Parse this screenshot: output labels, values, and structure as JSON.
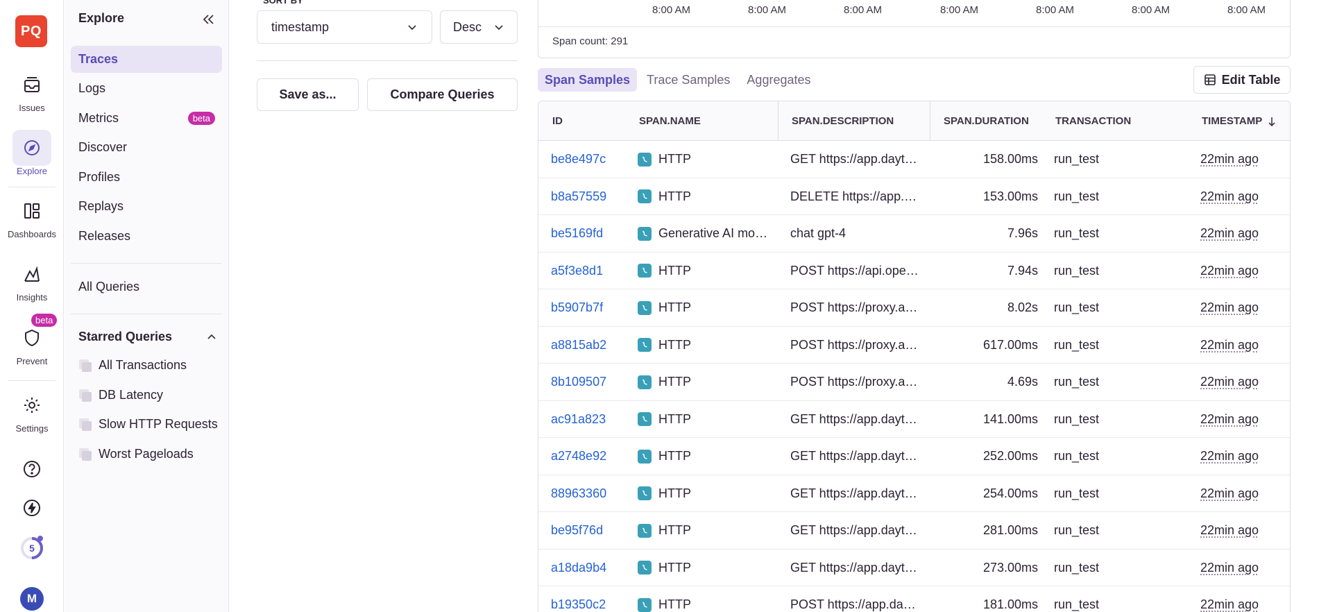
{
  "rail": {
    "logo": "PQ",
    "items": [
      {
        "label": "Issues",
        "icon": "inbox-icon"
      },
      {
        "label": "Explore",
        "icon": "compass-icon"
      },
      {
        "label": "Dashboards",
        "icon": "dashboard-icon"
      },
      {
        "label": "Insights",
        "icon": "insights-icon"
      },
      {
        "label": "Prevent",
        "icon": "shield-icon"
      },
      {
        "label": "Settings",
        "icon": "gear-icon"
      }
    ],
    "prevent_badge": "beta",
    "progress_count": "5",
    "avatar": "M"
  },
  "subnav": {
    "title": "Explore",
    "items": [
      {
        "label": "Traces"
      },
      {
        "label": "Logs"
      },
      {
        "label": "Metrics",
        "badge": "beta"
      },
      {
        "label": "Discover"
      },
      {
        "label": "Profiles"
      },
      {
        "label": "Replays"
      },
      {
        "label": "Releases"
      }
    ],
    "all_queries": "All Queries",
    "starred_title": "Starred Queries",
    "starred": [
      "All Transactions",
      "DB Latency",
      "Slow HTTP Requests",
      "Worst Pageloads"
    ]
  },
  "query": {
    "cut_label": "SORT BY",
    "sort_field": "timestamp",
    "sort_order": "Desc",
    "save_label": "Save as...",
    "compare_label": "Compare Queries"
  },
  "chart": {
    "ticks": [
      "8:00 AM",
      "8:00 AM",
      "8:00 AM",
      "8:00 AM",
      "8:00 AM",
      "8:00 AM",
      "8:00 AM"
    ],
    "span_count": "Span count: 291"
  },
  "tabs": [
    "Span Samples",
    "Trace Samples",
    "Aggregates"
  ],
  "edit_table": "Edit Table",
  "table": {
    "columns": [
      "ID",
      "SPAN.NAME",
      "SPAN.DESCRIPTION",
      "SPAN.DURATION",
      "TRANSACTION",
      "TIMESTAMP"
    ],
    "rows": [
      {
        "id": "be8e497c",
        "name": "HTTP",
        "desc": "GET https://app.dayt…",
        "dur": "158.00ms",
        "txn": "run_test",
        "ts": "22min ago"
      },
      {
        "id": "b8a57559",
        "name": "HTTP",
        "desc": "DELETE https://app.…",
        "dur": "153.00ms",
        "txn": "run_test",
        "ts": "22min ago"
      },
      {
        "id": "be5169fd",
        "name": "Generative AI mo…",
        "desc": "chat gpt-4",
        "dur": "7.96s",
        "txn": "run_test",
        "ts": "22min ago"
      },
      {
        "id": "a5f3e8d1",
        "name": "HTTP",
        "desc": "POST https://api.ope…",
        "dur": "7.94s",
        "txn": "run_test",
        "ts": "22min ago"
      },
      {
        "id": "b5907b7f",
        "name": "HTTP",
        "desc": "POST https://proxy.a…",
        "dur": "8.02s",
        "txn": "run_test",
        "ts": "22min ago"
      },
      {
        "id": "a8815ab2",
        "name": "HTTP",
        "desc": "POST https://proxy.a…",
        "dur": "617.00ms",
        "txn": "run_test",
        "ts": "22min ago"
      },
      {
        "id": "8b109507",
        "name": "HTTP",
        "desc": "POST https://proxy.a…",
        "dur": "4.69s",
        "txn": "run_test",
        "ts": "22min ago"
      },
      {
        "id": "ac91a823",
        "name": "HTTP",
        "desc": "GET https://app.dayt…",
        "dur": "141.00ms",
        "txn": "run_test",
        "ts": "22min ago"
      },
      {
        "id": "a2748e92",
        "name": "HTTP",
        "desc": "GET https://app.dayt…",
        "dur": "252.00ms",
        "txn": "run_test",
        "ts": "22min ago"
      },
      {
        "id": "88963360",
        "name": "HTTP",
        "desc": "GET https://app.dayt…",
        "dur": "254.00ms",
        "txn": "run_test",
        "ts": "22min ago"
      },
      {
        "id": "be95f76d",
        "name": "HTTP",
        "desc": "GET https://app.dayt…",
        "dur": "281.00ms",
        "txn": "run_test",
        "ts": "22min ago"
      },
      {
        "id": "a18da9b4",
        "name": "HTTP",
        "desc": "GET https://app.dayt…",
        "dur": "273.00ms",
        "txn": "run_test",
        "ts": "22min ago"
      },
      {
        "id": "b19350c2",
        "name": "HTTP",
        "desc": "POST https://app.da…",
        "dur": "181.00ms",
        "txn": "run_test",
        "ts": "22min ago"
      }
    ]
  },
  "colors": {
    "accent": "#6c5fc7",
    "link": "#2562d4",
    "logo": "#e8442f",
    "beta": "#c62da6"
  }
}
